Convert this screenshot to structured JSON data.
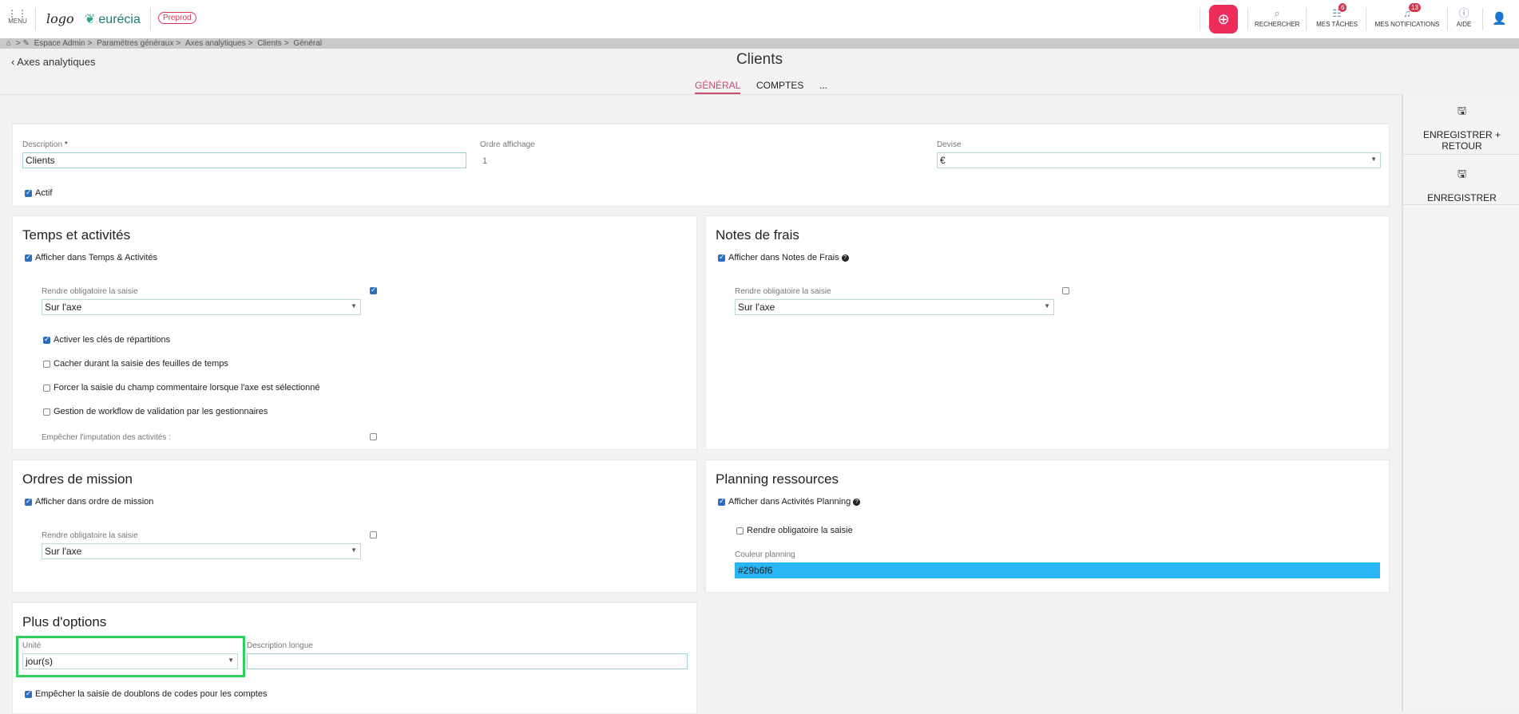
{
  "topbar": {
    "menu_label": "MENU",
    "logo_text": "logo",
    "brand": "eurécia",
    "env_badge": "Preprod",
    "search_label": "RECHERCHER",
    "tasks_label": "MES TÂCHES",
    "tasks_count": "6",
    "notifications_label": "MES NOTIFICATIONS",
    "notifications_count": "13",
    "help_label": "AIDE"
  },
  "breadcrumb": {
    "items": [
      "Espace Admin",
      "Paramètres généraux",
      "Axes analytiques",
      "Clients",
      "Général"
    ]
  },
  "header": {
    "back_label": "Axes analytiques",
    "title": "Clients",
    "tabs": [
      {
        "label": "GÉNÉRAL",
        "active": true
      },
      {
        "label": "COMPTES",
        "active": false
      },
      {
        "label": "...",
        "active": false
      }
    ]
  },
  "general": {
    "description_label": "Description",
    "description_required": "*",
    "description_value": "Clients",
    "order_label": "Ordre affichage",
    "order_value": "1",
    "currency_label": "Devise",
    "currency_value": "€",
    "active_label": "Actif",
    "active_checked": true
  },
  "temps": {
    "title": "Temps et activités",
    "show_label": "Afficher dans Temps & Activités",
    "show_checked": true,
    "mandatory_label": "Rendre obligatoire la saisie",
    "mandatory_checked": true,
    "mandatory_select": "Sur l'axe",
    "options": [
      {
        "label": "Activer les clés de répartitions",
        "checked": true
      },
      {
        "label": "Cacher durant la saisie des feuilles de temps",
        "checked": false
      },
      {
        "label": "Forcer la saisie du champ commentaire lorsque l'axe est sélectionné",
        "checked": false
      },
      {
        "label": "Gestion de workflow de validation par les gestionnaires",
        "checked": false
      }
    ],
    "prevent_label": "Empêcher l'imputation des activités :",
    "prevent_checked": false
  },
  "notes": {
    "title": "Notes de frais",
    "show_label": "Afficher dans Notes de Frais",
    "show_checked": true,
    "mandatory_label": "Rendre obligatoire la saisie",
    "mandatory_checked": false,
    "mandatory_select": "Sur l'axe"
  },
  "mission": {
    "title": "Ordres de mission",
    "show_label": "Afficher dans ordre de mission",
    "show_checked": true,
    "mandatory_label": "Rendre obligatoire la saisie",
    "mandatory_checked": false,
    "mandatory_select": "Sur l'axe"
  },
  "planning": {
    "title": "Planning ressources",
    "show_label": "Afficher dans Activités Planning",
    "show_checked": true,
    "mandatory_label": "Rendre obligatoire la saisie",
    "mandatory_checked": false,
    "color_label": "Couleur planning",
    "color_value": "#29b6f6"
  },
  "options": {
    "title": "Plus d'options",
    "unit_label": "Unité",
    "unit_value": "jour(s)",
    "long_desc_label": "Description longue",
    "long_desc_value": "",
    "no_dup_label": "Empêcher la saisie de doublons de codes pour les comptes",
    "no_dup_checked": true
  },
  "sidebar": {
    "save_return_label": "ENREGISTRER + RETOUR",
    "save_label": "ENREGISTRER"
  },
  "colors": {
    "accent": "#ec2c59",
    "tab_active": "#c94a6b",
    "highlight": "#2fd15a"
  }
}
